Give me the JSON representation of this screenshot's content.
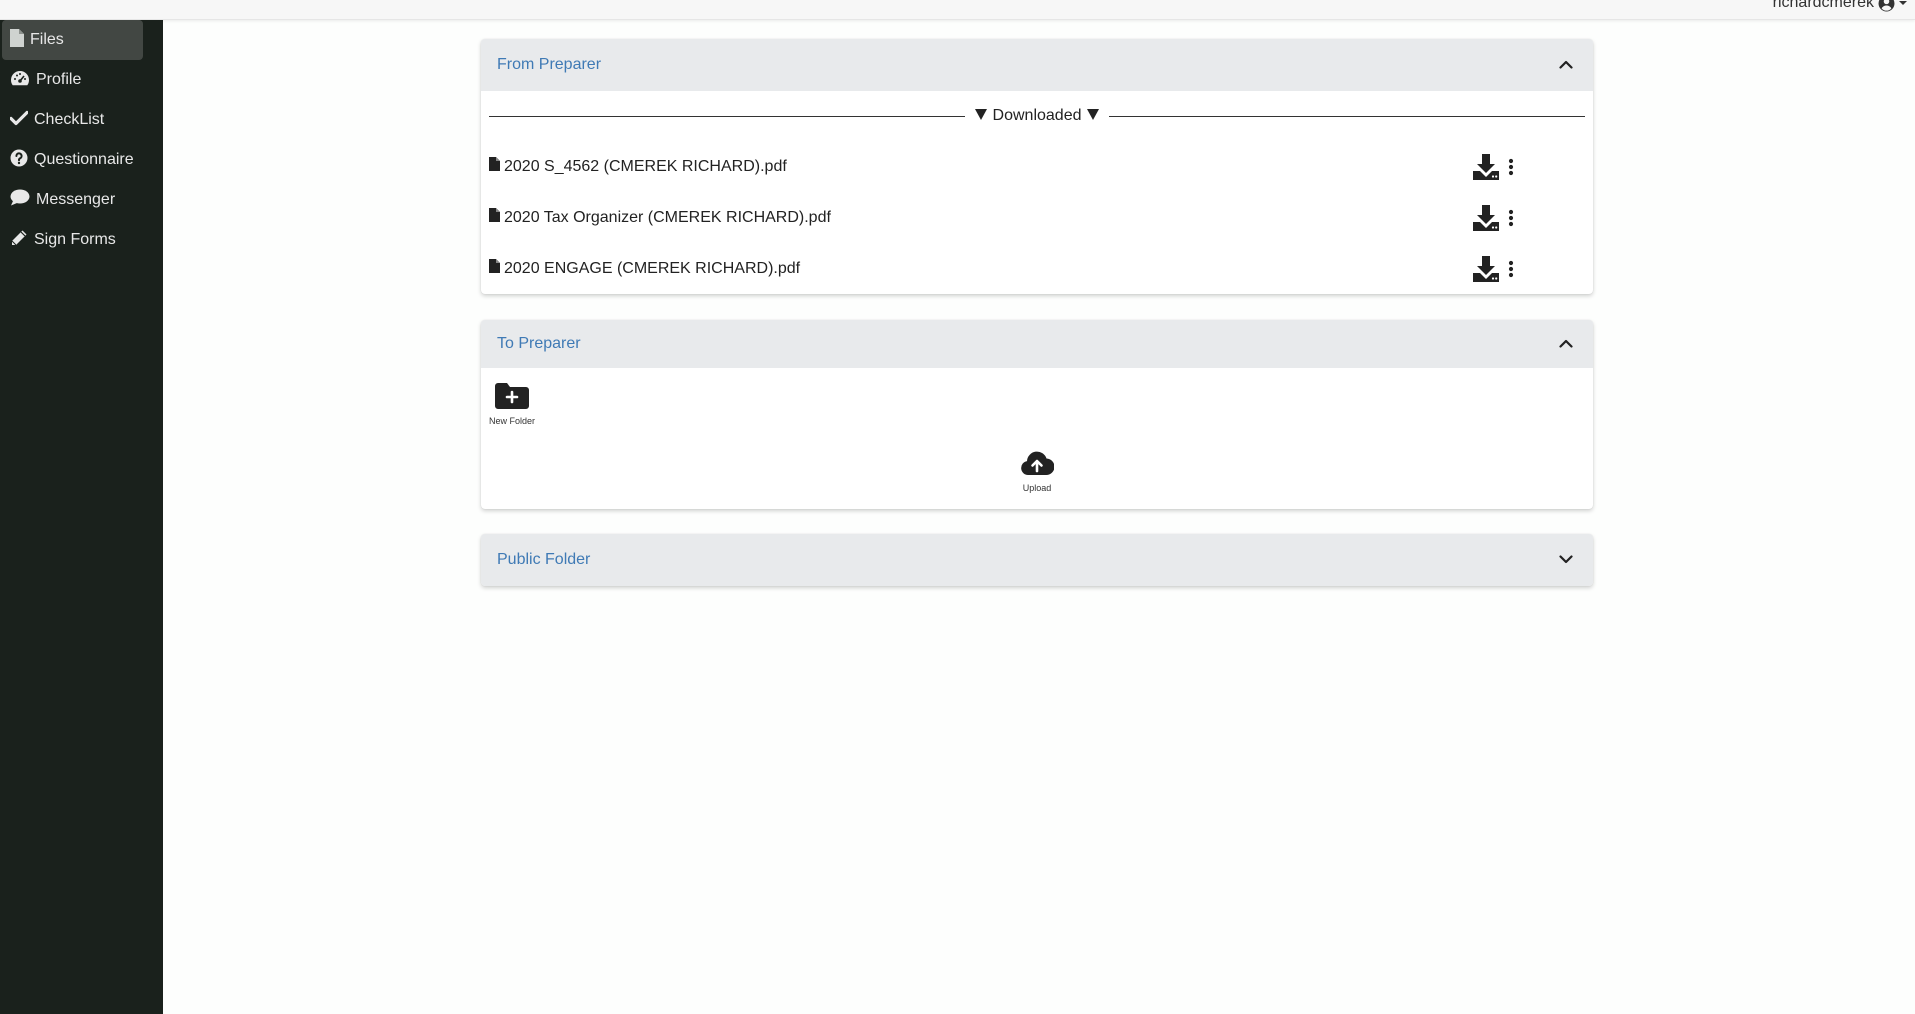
{
  "header": {
    "username": "richardcmerek"
  },
  "sidebar": {
    "items": [
      {
        "label": "Files",
        "icon": "file-icon"
      },
      {
        "label": "Profile",
        "icon": "dashboard-icon"
      },
      {
        "label": "CheckList",
        "icon": "check-icon"
      },
      {
        "label": "Questionnaire",
        "icon": "question-circle-icon"
      },
      {
        "label": "Messenger",
        "icon": "comment-icon"
      },
      {
        "label": "Sign Forms",
        "icon": "pencil-icon"
      }
    ],
    "active_index": 0
  },
  "panels": {
    "from_preparer": {
      "title": "From Preparer",
      "divider_label": "Downloaded",
      "files": [
        {
          "name": "2020 S_4562 (CMEREK RICHARD).pdf"
        },
        {
          "name": "2020 Tax Organizer (CMEREK RICHARD).pdf"
        },
        {
          "name": "2020 ENGAGE (CMEREK RICHARD).pdf"
        }
      ],
      "expanded": true
    },
    "to_preparer": {
      "title": "To Preparer",
      "new_folder_label": "New Folder",
      "upload_label": "Upload",
      "expanded": true
    },
    "public_folder": {
      "title": "Public Folder",
      "expanded": false
    }
  },
  "colors": {
    "sidebar_bg": "#1a211c",
    "sidebar_active": "#424743",
    "panel_header_bg": "#e8eaec",
    "panel_title": "#3f7ab5"
  }
}
